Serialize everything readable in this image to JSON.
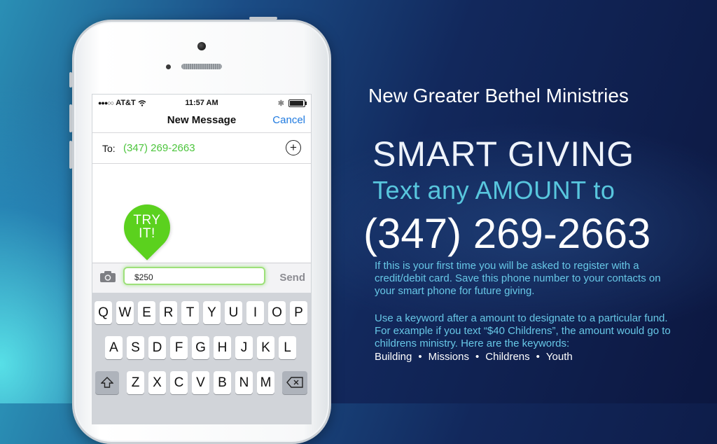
{
  "status_bar": {
    "carrier": "AT&T",
    "time": "11:57 AM"
  },
  "nav": {
    "title": "New Message",
    "cancel": "Cancel"
  },
  "recipient": {
    "label": "To:",
    "value": "(347) 269-2663"
  },
  "compose": {
    "message_value": "$250",
    "send": "Send"
  },
  "badge": {
    "line1": "TRY",
    "line2": "IT!"
  },
  "keyboard": {
    "row1": [
      "Q",
      "W",
      "E",
      "R",
      "T",
      "Y",
      "U",
      "I",
      "O",
      "P"
    ],
    "row2": [
      "A",
      "S",
      "D",
      "F",
      "G",
      "H",
      "J",
      "K",
      "L"
    ],
    "row3": [
      "Z",
      "X",
      "C",
      "V",
      "B",
      "N",
      "M"
    ]
  },
  "promo": {
    "org": "New Greater Bethel Ministries",
    "headline": "SMART GIVING",
    "subhead": "Text any AMOUNT to",
    "phone": "(347) 269-2663",
    "info1": "If this is your first time you will be asked to register with a credit/debit card. Save this phone number to your contacts on your smart phone for future giving.",
    "info2": "Use a keyword after a amount to designate to a particular fund. For example if you text “$40 Childrens”, the amount would go to childrens ministry. Here are the keywords:",
    "keywords": [
      "Building",
      "Missions",
      "Childrens",
      "Youth"
    ]
  },
  "colors": {
    "link_blue": "#1f7ae0",
    "green": "#4cc53c",
    "pin_green": "#5bd11e",
    "cyan_text": "#58c6dd"
  }
}
